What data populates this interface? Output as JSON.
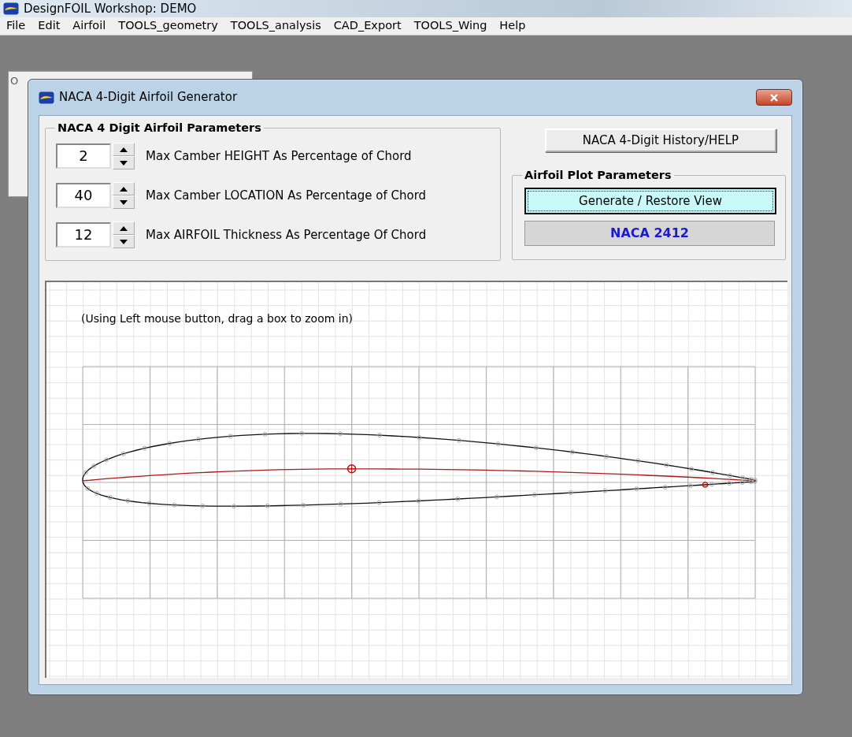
{
  "app": {
    "title": "DesignFOIL Workshop: DEMO"
  },
  "menu": [
    "File",
    "Edit",
    "Airfoil",
    "TOOLS_geometry",
    "TOOLS_analysis",
    "CAD_Export",
    "TOOLS_Wing",
    "Help"
  ],
  "background_window": {
    "title": "O"
  },
  "dialog": {
    "title": "NACA 4-Digit Airfoil Generator",
    "params_group": {
      "title": "NACA 4 Digit Airfoil Parameters",
      "params": [
        {
          "value": "2",
          "label": "Max Camber HEIGHT As Percentage of Chord"
        },
        {
          "value": "40",
          "label": "Max Camber LOCATION As Percentage of Chord"
        },
        {
          "value": "12",
          "label": "Max AIRFOIL Thickness As Percentage Of Chord"
        }
      ]
    },
    "help_button": "NACA 4-Digit History/HELP",
    "plot_group": {
      "title": "Airfoil Plot Parameters",
      "generate_button": "Generate / Restore View",
      "airfoil_name": "NACA 2412"
    },
    "plot": {
      "hint": "(Using Left mouse button, drag a box to zoom in)"
    }
  }
}
